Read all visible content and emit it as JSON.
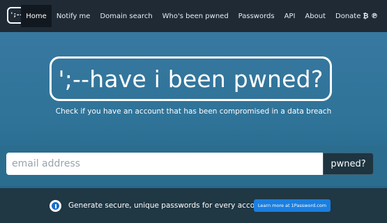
{
  "header": {
    "logo_text": "';--",
    "nav": [
      {
        "label": "Home",
        "active": true
      },
      {
        "label": "Notify me",
        "active": false
      },
      {
        "label": "Domain search",
        "active": false
      },
      {
        "label": "Who's been pwned",
        "active": false
      },
      {
        "label": "Passwords",
        "active": false
      },
      {
        "label": "API",
        "active": false
      },
      {
        "label": "About",
        "active": false
      },
      {
        "label": "Donate",
        "active": false
      }
    ],
    "donate_icons": "₿ ℗"
  },
  "hero": {
    "title": "';--have i been pwned?",
    "tagline": "Check if you have an account that has been compromised in a data breach"
  },
  "search": {
    "placeholder": "email address",
    "value": "",
    "button_label": "pwned?"
  },
  "promo": {
    "text": "Generate secure, unique passwords for every account",
    "button_label": "Learn more at 1Password.com",
    "icon": "1password-icon"
  },
  "colors": {
    "nav_bg": "#1f2a35",
    "hero_bg": "#3a7aa3",
    "button_dark": "#1e3440",
    "promo_button": "#1a7fe0"
  }
}
